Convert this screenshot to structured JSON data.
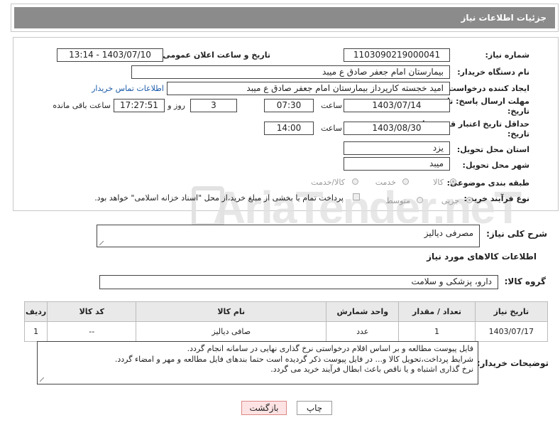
{
  "header": {
    "title": "جزئیات اطلاعات نیاز"
  },
  "form": {
    "need_number_label": "شماره نیاز:",
    "need_number": "1103090219000041",
    "announce_label": "تاریخ و ساعت اعلان عمومی:",
    "announce_value": "1403/07/10 - 13:14",
    "buyer_label": "نام دستگاه خریدار:",
    "buyer_value": "بیمارستان امام جعفر صادق  ع  میبد",
    "creator_label": "ایجاد کننده درخواست:",
    "creator_value": "امید خجسته کارپرداز بیمارستان امام جعفر صادق  ع  میبد",
    "contact_link": "اطلاعات تماس خریدار",
    "deadline_label_1": "مهلت ارسال پاسخ: تا",
    "deadline_label_2": "تاریخ:",
    "deadline_date": "1403/07/14",
    "time_label": "ساعت",
    "deadline_time": "07:30",
    "days_value": "3",
    "days_label": "روز و",
    "remaining_time": "17:27:51",
    "remaining_label": "ساعت باقی مانده",
    "validity_label_1": "حداقل تاریخ اعتبار قیمت: تا",
    "validity_label_2": "تاریخ:",
    "validity_date": "1403/08/30",
    "validity_time": "14:00",
    "province_label": "استان محل تحویل:",
    "province_value": "یزد",
    "city_label": "شهر محل تحویل:",
    "city_value": "میبد",
    "category_label": "طبقه بندی موضوعی:",
    "category_options": [
      "کالا",
      "خدمت",
      "کالا/خدمت"
    ],
    "process_label": "نوع فرآیند خرید :",
    "process_options": [
      "جزیی",
      "متوسط"
    ],
    "payment_note": "پرداخت تمام یا بخشی از مبلغ خرید،از محل \"اسناد خزانه اسلامی\" خواهد بود."
  },
  "summary": {
    "label": "شرح کلی نیاز:",
    "value": "مصرفی دیالیز"
  },
  "goods_section": {
    "title": "اطلاعات کالاهای مورد نیاز",
    "group_label": "گروه کالا:",
    "group_value": "دارو، پزشکی و سلامت"
  },
  "table": {
    "headers": {
      "row": "ردیف",
      "code": "کد کالا",
      "name": "نام کالا",
      "unit": "واحد شمارش",
      "qty": "تعداد / مقدار",
      "date": "تاریخ نیاز"
    },
    "rows": [
      {
        "row": "1",
        "code": "--",
        "name": "صافی دیالیز",
        "unit": "عدد",
        "qty": "1",
        "date": "1403/07/17"
      }
    ]
  },
  "buyer_notes": {
    "label": "توضیحات خریدار:",
    "lines": [
      "فایل پیوست مطالعه و بر اساس اقلام درخواستی نرخ گذاری نهایی در سامانه انجام گردد.",
      "شرایط پرداخت،تحویل کالا و... در فایل پیوست ذکر گردیده است حتما بندهای فایل مطالعه و مهر و امضاء گردد.",
      "نرخ گذاری اشتباه و یا ناقص باعث ابطال فرآیند خرید می گردد."
    ]
  },
  "buttons": {
    "print": "چاپ",
    "back": "بازگشت"
  },
  "watermark": "AriaTender.neT",
  "colors": {
    "header_bg": "#8b8b8b",
    "back_button_bg": "#fde3e3",
    "link": "#1a5ba8"
  }
}
